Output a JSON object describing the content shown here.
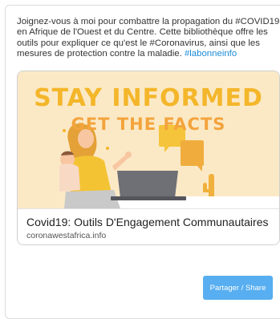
{
  "post": {
    "text_main": "Joignez-vous à moi pour combattre la propagation du #COVID19 en Afrique de l'Ouest et du Centre. Cette bibliothèque offre les outils pour expliquer ce qu'est le #Coronavirus, ainsi que les mesures de protection contre la maladie. ",
    "hashtag": "#labonneinfo"
  },
  "card": {
    "image": {
      "headline": "STAY INFORMED",
      "subheadline": "GET THE FACTS"
    },
    "title": "Covid19: Outils D'Engagement Communautaires",
    "domain": "coronawestafrica.info"
  },
  "actions": {
    "share_label": "Partager / Share"
  },
  "colors": {
    "hashtag": "#1b8bd6",
    "headline": "#f4b62a",
    "subheadline": "#f3a43c",
    "image_bg": "#fbe9c6",
    "share_button": "#57aef0"
  }
}
